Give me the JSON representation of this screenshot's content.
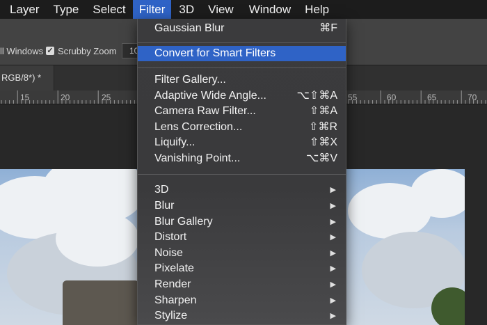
{
  "menubar": {
    "items": [
      "Layer",
      "Type",
      "Select",
      "Filter",
      "3D",
      "View",
      "Window",
      "Help"
    ],
    "active_index": 3
  },
  "options": {
    "windows_label": "ll Windows",
    "scrubby_label": "Scrubby Zoom",
    "scrubby_checked": true,
    "zoom_value": "10"
  },
  "document_tab": {
    "title": "RGB/8*) *"
  },
  "ruler": {
    "left_labels": [
      "15",
      "20",
      "25"
    ],
    "right_labels": [
      "55",
      "60",
      "65",
      "70"
    ]
  },
  "filter_menu": {
    "group1": [
      {
        "label": "Gaussian Blur",
        "shortcut": "⌘F"
      }
    ],
    "group2": [
      {
        "label": "Convert for Smart Filters",
        "highlighted": true
      }
    ],
    "group3": [
      {
        "label": "Filter Gallery...",
        "shortcut": ""
      },
      {
        "label": "Adaptive Wide Angle...",
        "shortcut": "⌥⇧⌘A"
      },
      {
        "label": "Camera Raw Filter...",
        "shortcut": "⇧⌘A"
      },
      {
        "label": "Lens Correction...",
        "shortcut": "⇧⌘R"
      },
      {
        "label": "Liquify...",
        "shortcut": "⇧⌘X"
      },
      {
        "label": "Vanishing Point...",
        "shortcut": "⌥⌘V"
      }
    ],
    "group4": [
      {
        "label": "3D",
        "submenu_arrow": "▶"
      },
      {
        "label": "Blur",
        "submenu_arrow": "▶"
      },
      {
        "label": "Blur Gallery",
        "submenu_arrow": "▶"
      },
      {
        "label": "Distort",
        "submenu_arrow": "▶"
      },
      {
        "label": "Noise",
        "submenu_arrow": "▶"
      },
      {
        "label": "Pixelate",
        "submenu_arrow": "▶"
      },
      {
        "label": "Render",
        "submenu_arrow": "▶"
      },
      {
        "label": "Sharpen",
        "submenu_arrow": "▶"
      },
      {
        "label": "Stylize",
        "submenu_arrow": "▶"
      }
    ]
  },
  "colors": {
    "highlight": "#2f63c6",
    "menubar_bg": "#1c1c1c",
    "menu_bg": "#3b3b3d"
  }
}
